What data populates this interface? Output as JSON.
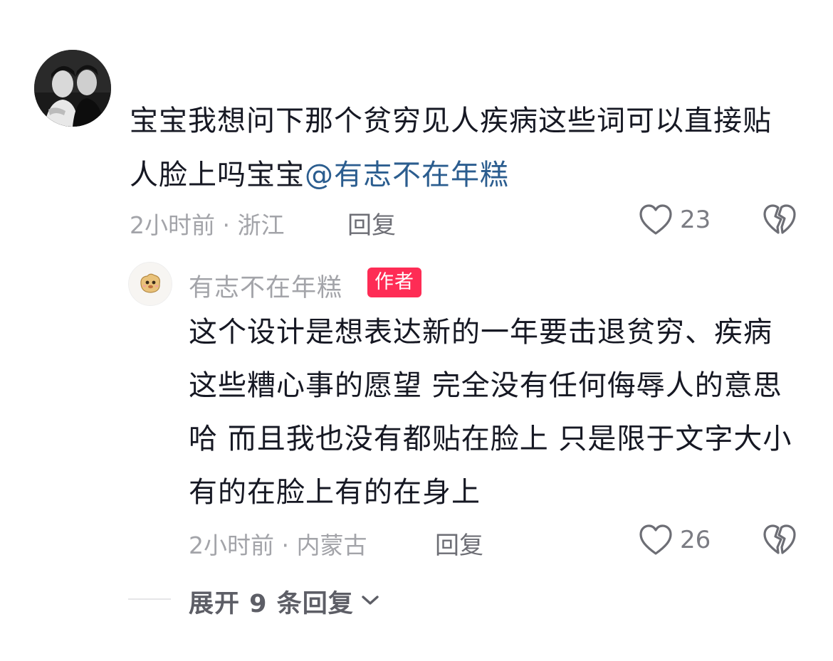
{
  "comment": {
    "text": "宝宝我想问下那个贫穷见人疾病这些词可以直接贴人脸上吗宝宝",
    "mention": "@有志不在年糕",
    "time": "2小时前",
    "location": "浙江",
    "reply_label": "回复",
    "likes": "23",
    "avatar_icon": "couple-photo-avatar"
  },
  "reply": {
    "author": "有志不在年糕",
    "badge": "作者",
    "text": "这个设计是想表达新的一年要击退贫穷、疾病这些糟心事的愿望 完全没有任何侮辱人的意思哈 而且我也没有都贴在脸上 只是限于文字大小有的在脸上有的在身上",
    "time": "2小时前",
    "location": "内蒙古",
    "reply_label": "回复",
    "likes": "26",
    "avatar_icon": "cartoon-avatar"
  },
  "expand": {
    "label": "展开 9 条回复"
  },
  "colors": {
    "badge": "#fe2c55",
    "mention": "#2b5d8f",
    "text": "#161823",
    "meta": "#a3a4a9"
  }
}
